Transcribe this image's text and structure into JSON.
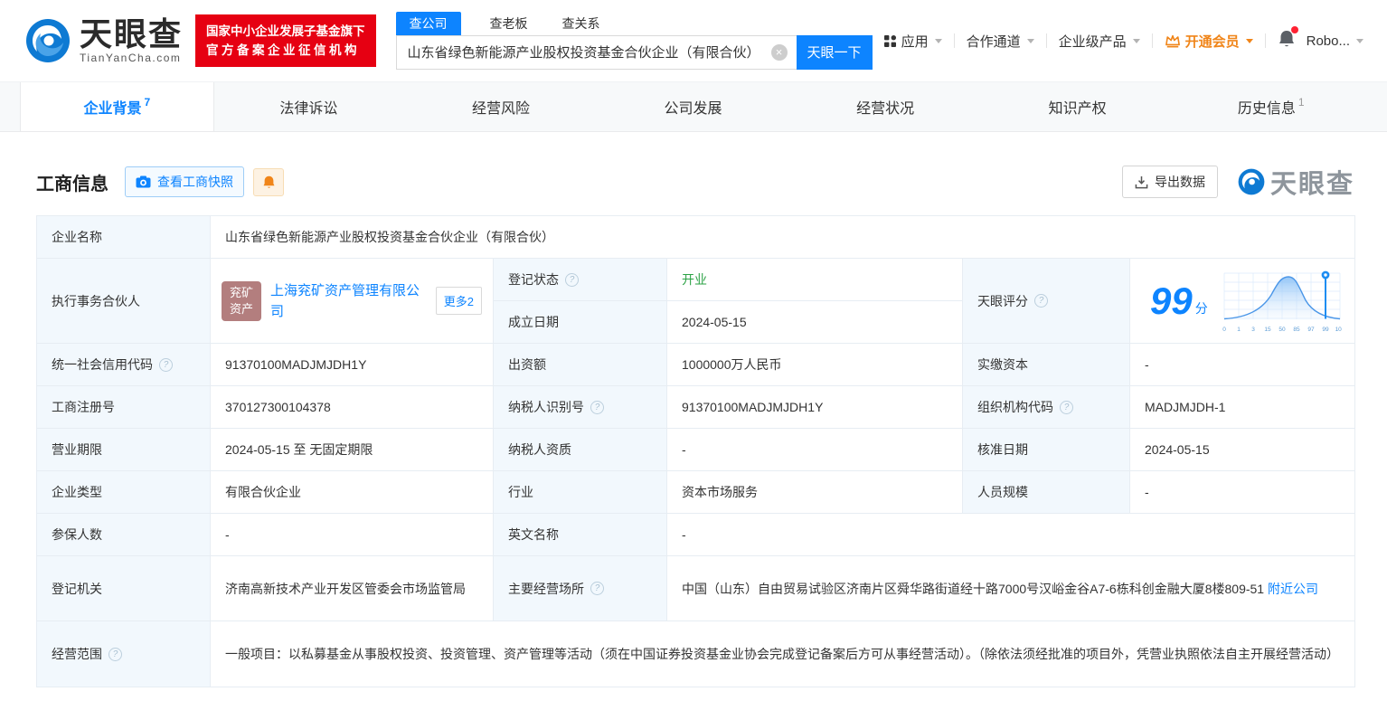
{
  "colors": {
    "accent": "#0d84ff",
    "badge_red": "#e60012",
    "status_green": "#2ba245",
    "vip_orange": "#f08519",
    "label_bg": "#f2f8fd",
    "border": "#e7edf3"
  },
  "icons": {
    "clear": "×",
    "dropdown": "▾",
    "help": "?"
  },
  "header": {
    "brand": "天眼查",
    "brand_domain": "TianYanCha.com",
    "badge_line1": "国家中小企业发展子基金旗下",
    "badge_line2": "官方备案企业征信机构",
    "search": {
      "tabs": [
        {
          "label": "查公司",
          "active": true
        },
        {
          "label": "查老板"
        },
        {
          "label": "查关系"
        }
      ],
      "input_value": "山东省绿色新能源产业股权投资基金合伙企业（有限合伙）",
      "button_label": "天眼一下"
    },
    "nav": {
      "apps": "应用",
      "cooperation": "合作通道",
      "enterprise": "企业级产品",
      "vip": "开通会员",
      "user": "Robo..."
    }
  },
  "tabs": [
    {
      "label": "企业背景",
      "count": "7",
      "active": true
    },
    {
      "label": "法律诉讼"
    },
    {
      "label": "经营风险"
    },
    {
      "label": "公司发展"
    },
    {
      "label": "经营状况"
    },
    {
      "label": "知识产权"
    },
    {
      "label": "历史信息",
      "count": "1"
    }
  ],
  "section": {
    "title": "工商信息",
    "snapshot_button": "查看工商快照",
    "export_button": "导出数据",
    "watermark": "天眼查"
  },
  "info": {
    "name": {
      "label": "企业名称",
      "value": "山东省绿色新能源产业股权投资基金合伙企业（有限合伙）"
    },
    "partner": {
      "label": "执行事务合伙人",
      "avatar_line1": "兖矿",
      "avatar_line2": "资产",
      "company": "上海兖矿资产管理有限公司",
      "more": "更多2"
    },
    "reg_status": {
      "label": "登记状态",
      "value": "开业"
    },
    "est_date": {
      "label": "成立日期",
      "value": "2024-05-15"
    },
    "score": {
      "label": "天眼评分",
      "value": "99",
      "unit": "分"
    },
    "credit_code": {
      "label": "统一社会信用代码",
      "value": "91370100MADJMJDH1Y"
    },
    "capital": {
      "label": "出资额",
      "value": "1000000万人民币"
    },
    "paid_capital": {
      "label": "实缴资本",
      "value": "-"
    },
    "reg_number": {
      "label": "工商注册号",
      "value": "370127300104378"
    },
    "taxpayer_id": {
      "label": "纳税人识别号",
      "value": "91370100MADJMJDH1Y"
    },
    "org_code": {
      "label": "组织机构代码",
      "value": "MADJMJDH-1"
    },
    "business_term": {
      "label": "营业期限",
      "value": "2024-05-15 至 无固定期限"
    },
    "taxpayer_quality": {
      "label": "纳税人资质",
      "value": "-"
    },
    "approval_date": {
      "label": "核准日期",
      "value": "2024-05-15"
    },
    "company_type": {
      "label": "企业类型",
      "value": "有限合伙企业"
    },
    "industry": {
      "label": "行业",
      "value": "资本市场服务"
    },
    "staff_size": {
      "label": "人员规模",
      "value": "-"
    },
    "insured": {
      "label": "参保人数",
      "value": "-"
    },
    "english_name": {
      "label": "英文名称",
      "value": "-"
    },
    "reg_authority": {
      "label": "登记机关",
      "value": "济南高新技术产业开发区管委会市场监管局"
    },
    "address": {
      "label": "主要经营场所",
      "value": "中国（山东）自由贸易试验区济南片区舜华路街道经十路7000号汉峪金谷A7-6栋科创金融大厦8楼809-51",
      "link": "附近公司"
    },
    "business_scope": {
      "label": "经营范围",
      "value": "一般项目：以私募基金从事股权投资、投资管理、资产管理等活动（须在中国证券投资基金业协会完成登记备案后方可从事经营活动）。（除依法须经批准的项目外，凭营业执照依法自主开展经营活动）"
    }
  },
  "score_chart": {
    "type": "area",
    "title": "天眼评分分布",
    "ticks": [
      "0",
      "1",
      "3",
      "15",
      "50",
      "85",
      "97",
      "99",
      "100"
    ],
    "marker_value": "99",
    "score": 99
  }
}
